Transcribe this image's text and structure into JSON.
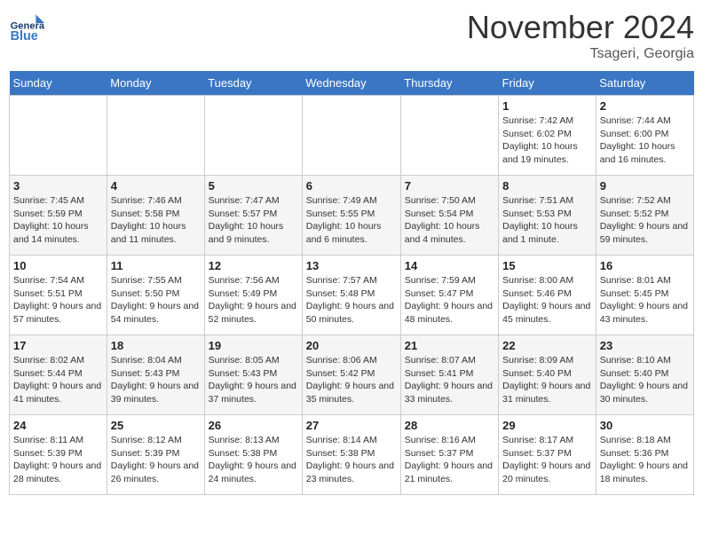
{
  "logo": {
    "general": "General",
    "blue": "Blue"
  },
  "title": "November 2024",
  "location": "Tsageri, Georgia",
  "days_header": [
    "Sunday",
    "Monday",
    "Tuesday",
    "Wednesday",
    "Thursday",
    "Friday",
    "Saturday"
  ],
  "weeks": [
    [
      {
        "day": "",
        "info": ""
      },
      {
        "day": "",
        "info": ""
      },
      {
        "day": "",
        "info": ""
      },
      {
        "day": "",
        "info": ""
      },
      {
        "day": "",
        "info": ""
      },
      {
        "day": "1",
        "info": "Sunrise: 7:42 AM\nSunset: 6:02 PM\nDaylight: 10 hours and 19 minutes."
      },
      {
        "day": "2",
        "info": "Sunrise: 7:44 AM\nSunset: 6:00 PM\nDaylight: 10 hours and 16 minutes."
      }
    ],
    [
      {
        "day": "3",
        "info": "Sunrise: 7:45 AM\nSunset: 5:59 PM\nDaylight: 10 hours and 14 minutes."
      },
      {
        "day": "4",
        "info": "Sunrise: 7:46 AM\nSunset: 5:58 PM\nDaylight: 10 hours and 11 minutes."
      },
      {
        "day": "5",
        "info": "Sunrise: 7:47 AM\nSunset: 5:57 PM\nDaylight: 10 hours and 9 minutes."
      },
      {
        "day": "6",
        "info": "Sunrise: 7:49 AM\nSunset: 5:55 PM\nDaylight: 10 hours and 6 minutes."
      },
      {
        "day": "7",
        "info": "Sunrise: 7:50 AM\nSunset: 5:54 PM\nDaylight: 10 hours and 4 minutes."
      },
      {
        "day": "8",
        "info": "Sunrise: 7:51 AM\nSunset: 5:53 PM\nDaylight: 10 hours and 1 minute."
      },
      {
        "day": "9",
        "info": "Sunrise: 7:52 AM\nSunset: 5:52 PM\nDaylight: 9 hours and 59 minutes."
      }
    ],
    [
      {
        "day": "10",
        "info": "Sunrise: 7:54 AM\nSunset: 5:51 PM\nDaylight: 9 hours and 57 minutes."
      },
      {
        "day": "11",
        "info": "Sunrise: 7:55 AM\nSunset: 5:50 PM\nDaylight: 9 hours and 54 minutes."
      },
      {
        "day": "12",
        "info": "Sunrise: 7:56 AM\nSunset: 5:49 PM\nDaylight: 9 hours and 52 minutes."
      },
      {
        "day": "13",
        "info": "Sunrise: 7:57 AM\nSunset: 5:48 PM\nDaylight: 9 hours and 50 minutes."
      },
      {
        "day": "14",
        "info": "Sunrise: 7:59 AM\nSunset: 5:47 PM\nDaylight: 9 hours and 48 minutes."
      },
      {
        "day": "15",
        "info": "Sunrise: 8:00 AM\nSunset: 5:46 PM\nDaylight: 9 hours and 45 minutes."
      },
      {
        "day": "16",
        "info": "Sunrise: 8:01 AM\nSunset: 5:45 PM\nDaylight: 9 hours and 43 minutes."
      }
    ],
    [
      {
        "day": "17",
        "info": "Sunrise: 8:02 AM\nSunset: 5:44 PM\nDaylight: 9 hours and 41 minutes."
      },
      {
        "day": "18",
        "info": "Sunrise: 8:04 AM\nSunset: 5:43 PM\nDaylight: 9 hours and 39 minutes."
      },
      {
        "day": "19",
        "info": "Sunrise: 8:05 AM\nSunset: 5:43 PM\nDaylight: 9 hours and 37 minutes."
      },
      {
        "day": "20",
        "info": "Sunrise: 8:06 AM\nSunset: 5:42 PM\nDaylight: 9 hours and 35 minutes."
      },
      {
        "day": "21",
        "info": "Sunrise: 8:07 AM\nSunset: 5:41 PM\nDaylight: 9 hours and 33 minutes."
      },
      {
        "day": "22",
        "info": "Sunrise: 8:09 AM\nSunset: 5:40 PM\nDaylight: 9 hours and 31 minutes."
      },
      {
        "day": "23",
        "info": "Sunrise: 8:10 AM\nSunset: 5:40 PM\nDaylight: 9 hours and 30 minutes."
      }
    ],
    [
      {
        "day": "24",
        "info": "Sunrise: 8:11 AM\nSunset: 5:39 PM\nDaylight: 9 hours and 28 minutes."
      },
      {
        "day": "25",
        "info": "Sunrise: 8:12 AM\nSunset: 5:39 PM\nDaylight: 9 hours and 26 minutes."
      },
      {
        "day": "26",
        "info": "Sunrise: 8:13 AM\nSunset: 5:38 PM\nDaylight: 9 hours and 24 minutes."
      },
      {
        "day": "27",
        "info": "Sunrise: 8:14 AM\nSunset: 5:38 PM\nDaylight: 9 hours and 23 minutes."
      },
      {
        "day": "28",
        "info": "Sunrise: 8:16 AM\nSunset: 5:37 PM\nDaylight: 9 hours and 21 minutes."
      },
      {
        "day": "29",
        "info": "Sunrise: 8:17 AM\nSunset: 5:37 PM\nDaylight: 9 hours and 20 minutes."
      },
      {
        "day": "30",
        "info": "Sunrise: 8:18 AM\nSunset: 5:36 PM\nDaylight: 9 hours and 18 minutes."
      }
    ]
  ]
}
